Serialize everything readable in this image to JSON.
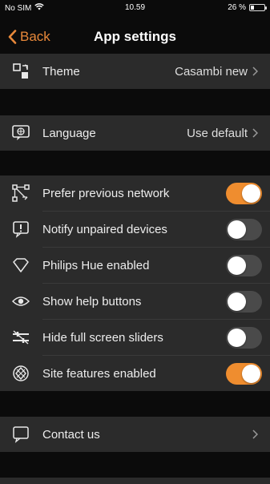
{
  "status_bar": {
    "carrier": "No SIM",
    "time": "10.59",
    "battery": "26 %",
    "battery_level": 0.26
  },
  "nav": {
    "back_label": "Back",
    "title": "App settings"
  },
  "theme_section": {
    "label": "Theme",
    "value": "Casambi new"
  },
  "language_section": {
    "label": "Language",
    "value": "Use default"
  },
  "toggles": [
    {
      "label": "Prefer previous network",
      "on": true,
      "icon": "network-icon"
    },
    {
      "label": "Notify unpaired devices",
      "on": false,
      "icon": "alert-bubble-icon"
    },
    {
      "label": "Philips Hue enabled",
      "on": false,
      "icon": "diamond-icon"
    },
    {
      "label": "Show help buttons",
      "on": false,
      "icon": "eye-icon"
    },
    {
      "label": "Hide full screen sliders",
      "on": false,
      "icon": "sliders-icon"
    },
    {
      "label": "Site features enabled",
      "on": true,
      "icon": "site-icon"
    }
  ],
  "contact_section": {
    "label": "Contact us"
  },
  "colors": {
    "accent": "#ef8d2f",
    "background": "#0b0b0b",
    "cell": "#2b2b2b"
  }
}
